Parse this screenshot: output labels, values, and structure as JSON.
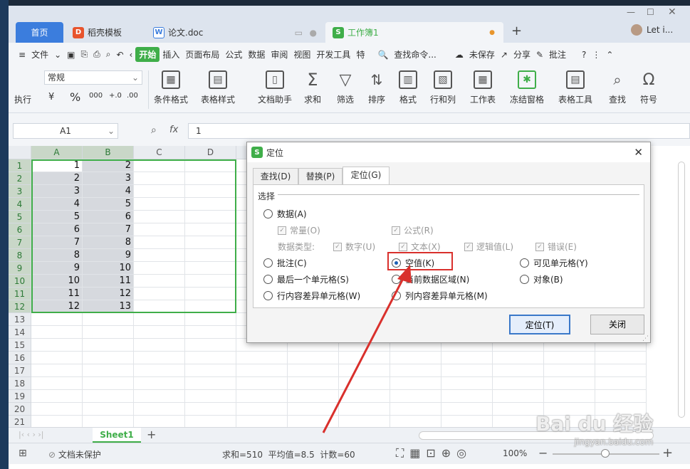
{
  "tabs": {
    "home": "首页",
    "templates": "稻壳模板",
    "doc": "论文.doc",
    "workbook": "工作簿1",
    "user": "Let i...",
    "add": "+"
  },
  "menu": {
    "file": "文件",
    "items": [
      "开始",
      "插入",
      "页面布局",
      "公式",
      "数据",
      "审阅",
      "视图",
      "开发工具",
      "特"
    ],
    "search": "查找命令...",
    "unsaved": "未保存",
    "share": "分享",
    "comment": "批注",
    "help": "?"
  },
  "ribbon": {
    "format_select": "常规",
    "exec_label": "执行",
    "currency": "¥",
    "percent": "%",
    "thousands": "000",
    "dec_inc": "+.0",
    "dec_dec": ".00",
    "cond_format": "条件格式",
    "table_style": "表格样式",
    "doc_helper": "文档助手",
    "sum": "求和",
    "filter": "筛选",
    "sort": "排序",
    "format": "格式",
    "rowcol": "行和列",
    "worksheet": "工作表",
    "freeze": "冻结窗格",
    "table_tools": "表格工具",
    "find": "查找",
    "symbol": "符号"
  },
  "formula_bar": {
    "cell_ref": "A1",
    "fx": "fx",
    "value": "1"
  },
  "grid": {
    "columns": [
      "A",
      "B",
      "C",
      "D"
    ],
    "col_n": "N",
    "rows": [
      "1",
      "2",
      "3",
      "4",
      "5",
      "6",
      "7",
      "8",
      "9",
      "10",
      "11",
      "12",
      "13",
      "14",
      "15",
      "16",
      "17",
      "18",
      "19",
      "20",
      "21"
    ],
    "colA": [
      "1",
      "2",
      "3",
      "4",
      "5",
      "6",
      "7",
      "8",
      "9",
      "10",
      "11",
      "12"
    ],
    "colB": [
      "2",
      "3",
      "4",
      "5",
      "6",
      "7",
      "8",
      "9",
      "10",
      "11",
      "12",
      "13"
    ]
  },
  "sheet": {
    "name": "Sheet1",
    "add": "+"
  },
  "status": {
    "protect": "文档未保护",
    "stats": "求和=510  平均值=8.5  计数=60",
    "zoom": "100%"
  },
  "dialog": {
    "title": "定位",
    "tabs": [
      "查找(D)",
      "替换(P)",
      "定位(G)"
    ],
    "section": "选择",
    "data": "数据(A)",
    "constant": "常量(O)",
    "formula": "公式(R)",
    "data_type": "数据类型:",
    "number": "数字(U)",
    "text": "文本(X)",
    "logic": "逻辑值(L)",
    "error": "错误(E)",
    "comment": "批注(C)",
    "blank": "空值(K)",
    "visible": "可见单元格(Y)",
    "last_cell": "最后一个单元格(S)",
    "current_region": "当前数据区域(N)",
    "object": "对象(B)",
    "row_diff": "行内容差异单元格(W)",
    "col_diff": "列内容差异单元格(M)",
    "locate_btn": "定位(T)",
    "close_btn": "关闭"
  },
  "watermark": {
    "brand": "Bai du 经验",
    "url": "jingyan.baidu.com"
  },
  "colors": {
    "accent": "#3b7ddd",
    "green": "#3fae49",
    "highlight": "#d9302c"
  }
}
